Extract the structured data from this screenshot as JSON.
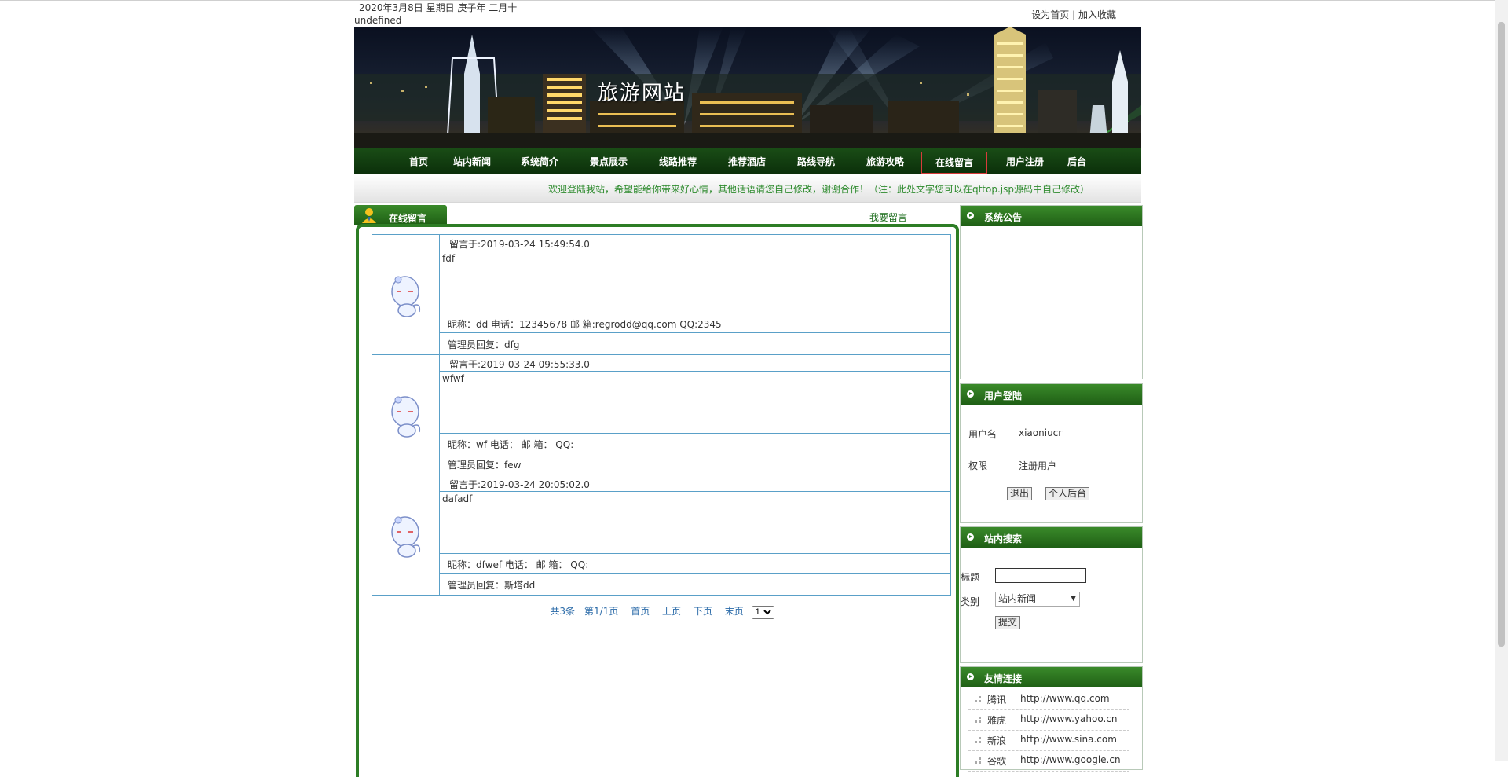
{
  "header": {
    "date": "2020年3月8日 星期日 庚子年 二月十",
    "undefined_text": "undefined",
    "set_home": "设为首页",
    "separator": "|",
    "add_favorite": "加入收藏"
  },
  "banner": {
    "title": "旅游网站"
  },
  "nav": {
    "items": [
      "首页",
      "站内新闻",
      "系统简介",
      "景点展示",
      "线路推荐",
      "推荐酒店",
      "路线导航",
      "旅游攻略",
      "在线留言",
      "用户注册",
      "后台"
    ],
    "active": "在线留言"
  },
  "welcome": "欢迎登陆我站，希望能给你带来好心情，其他话语请您自己修改，谢谢合作！（注：此处文字您可以在qttop.jsp源码中自己修改）",
  "guestbook": {
    "tab_title": "在线留言",
    "leave_message": "我要留言",
    "messages": [
      {
        "time": "留言于:2019-03-24 15:49:54.0",
        "content": "fdf",
        "info": "昵称：dd   电话：12345678  邮 箱:regrodd@qq.com   QQ:2345",
        "reply": "管理员回复：dfg"
      },
      {
        "time": "留言于:2019-03-24 09:55:33.0",
        "content": "wfwf",
        "info": "昵称：wf   电话：  邮 箱：  QQ:",
        "reply": "管理员回复：few"
      },
      {
        "time": "留言于:2019-03-24 20:05:02.0",
        "content": "dafadf",
        "info": "昵称：dfwef   电话：  邮 箱：  QQ:",
        "reply": "管理员回复：斯塔dd"
      }
    ],
    "pager": {
      "total": "共3条",
      "page": "第1/1页",
      "first": "首页",
      "prev": "上页",
      "next": "下页",
      "last": "末页",
      "select_value": "1"
    }
  },
  "sidebar": {
    "notice": {
      "title": "系统公告"
    },
    "login": {
      "title": "用户登陆",
      "username_label": "用户名",
      "username": "xiaoniucr",
      "role_label": "权限",
      "role": "注册用户",
      "logout": "退出",
      "personal": "个人后台"
    },
    "search": {
      "title": "站内搜索",
      "title_label": "标题",
      "category_label": "类别",
      "category_value": "站内新闻",
      "submit": "提交"
    },
    "links": {
      "title": "友情连接",
      "items": [
        {
          "name": "腾讯",
          "url": "http://www.qq.com"
        },
        {
          "name": "雅虎",
          "url": "http://www.yahoo.cn"
        },
        {
          "name": "新浪",
          "url": "http://www.sina.com"
        },
        {
          "name": "谷歌",
          "url": "http://www.google.cn"
        }
      ]
    }
  },
  "colors": {
    "nav_bg": "#0b2f0a",
    "accent_green": "#2d7d25",
    "welcome_text": "#2e8b2e",
    "table_border": "#5aa0c8",
    "pager_link": "#2a6aa8"
  }
}
